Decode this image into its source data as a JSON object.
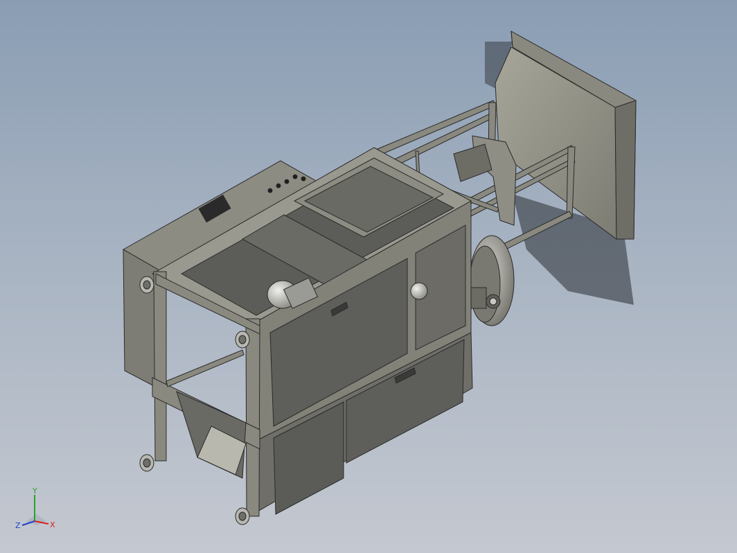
{
  "viewport": {
    "background_top": "#8a9db3",
    "background_bottom": "#c4c8d0",
    "model_color": "#8c8b82"
  },
  "triad": {
    "x_label": "X",
    "y_label": "Y",
    "z_label": "Z",
    "x_color": "#d92020",
    "y_color": "#2da02d",
    "z_color": "#2040d0"
  }
}
